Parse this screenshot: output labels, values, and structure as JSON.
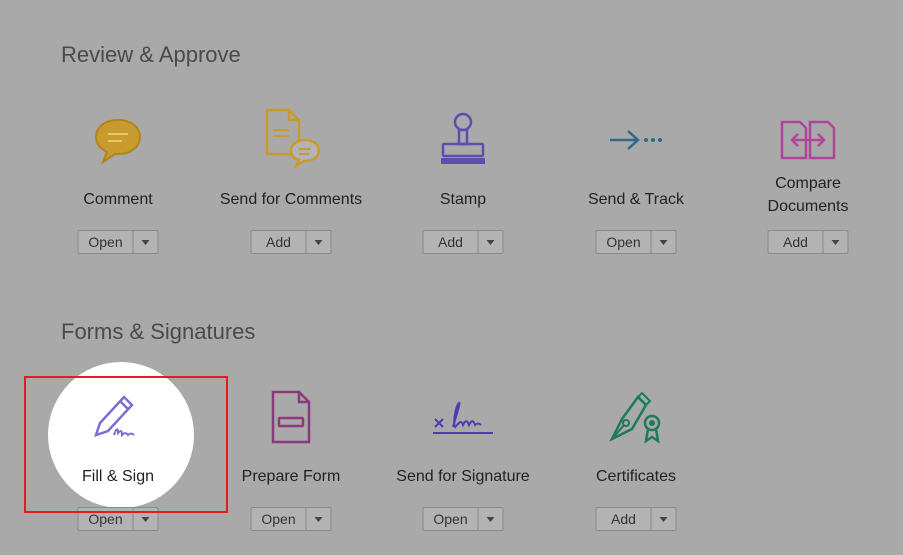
{
  "sections": {
    "review": {
      "title": "Review & Approve",
      "tools": [
        {
          "label": "Comment",
          "button": "Open",
          "icon": "comment-icon",
          "color": "#c99a2e"
        },
        {
          "label": "Send for Comments",
          "button": "Add",
          "icon": "send-for-comments-icon",
          "color": "#c99a2e"
        },
        {
          "label": "Stamp",
          "button": "Add",
          "icon": "stamp-icon",
          "color": "#5a4fb0"
        },
        {
          "label": "Send & Track",
          "button": "Open",
          "icon": "send-track-icon",
          "color": "#2e6a8a"
        },
        {
          "label": "Compare Documents",
          "button": "Add",
          "icon": "compare-documents-icon",
          "color": "#b0449a"
        }
      ]
    },
    "forms": {
      "title": "Forms & Signatures",
      "tools": [
        {
          "label": "Fill & Sign",
          "button": "Open",
          "icon": "fill-sign-icon",
          "color": "#7a6fd0"
        },
        {
          "label": "Prepare Form",
          "button": "Open",
          "icon": "prepare-form-icon",
          "color": "#8a3a7a"
        },
        {
          "label": "Send for Signature",
          "button": "Open",
          "icon": "send-for-signature-icon",
          "color": "#4a3fb0"
        },
        {
          "label": "Certificates",
          "button": "Add",
          "icon": "certificates-icon",
          "color": "#1f7a5a"
        }
      ]
    }
  }
}
